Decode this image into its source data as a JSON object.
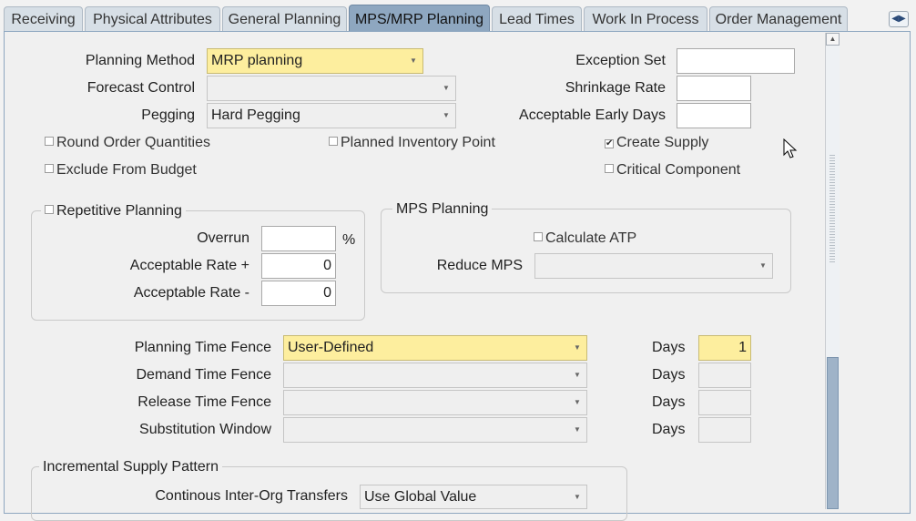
{
  "tabs": [
    {
      "label": "Receiving",
      "active": false
    },
    {
      "label": "Physical Attributes",
      "active": false
    },
    {
      "label": "General Planning",
      "active": false
    },
    {
      "label": "MPS/MRP Planning",
      "active": true
    },
    {
      "label": "Lead Times",
      "active": false
    },
    {
      "label": "Work In Process",
      "active": false
    },
    {
      "label": "Order Management",
      "active": false
    }
  ],
  "tab_nav_icon": "left-right-arrows-icon",
  "main": {
    "planning_method_label": "Planning Method",
    "planning_method_value": "MRP planning",
    "forecast_control_label": "Forecast Control",
    "forecast_control_value": "",
    "pegging_label": "Pegging",
    "pegging_value": "Hard Pegging",
    "exception_set_label": "Exception Set",
    "exception_set_value": "",
    "shrinkage_rate_label": "Shrinkage Rate",
    "shrinkage_rate_value": "",
    "acceptable_early_days_label": "Acceptable Early Days",
    "acceptable_early_days_value": "",
    "checkboxes": {
      "round_order_quantities": {
        "label": "Round Order Quantities",
        "checked": false
      },
      "planned_inventory_point": {
        "label": "Planned Inventory Point",
        "checked": false
      },
      "create_supply": {
        "label": "Create Supply",
        "checked": true
      },
      "exclude_from_budget": {
        "label": "Exclude From Budget",
        "checked": false
      },
      "critical_component": {
        "label": "Critical Component",
        "checked": false
      }
    }
  },
  "repetitive": {
    "title": "Repetitive Planning",
    "checked": false,
    "overrun_label": "Overrun",
    "overrun_value": "",
    "percent_sign": "%",
    "rate_plus_label": "Acceptable Rate +",
    "rate_plus_value": "0",
    "rate_minus_label": "Acceptable Rate -",
    "rate_minus_value": "0"
  },
  "mps": {
    "title": "MPS Planning",
    "calculate_atp_label": "Calculate ATP",
    "calculate_atp_checked": false,
    "reduce_mps_label": "Reduce MPS",
    "reduce_mps_value": ""
  },
  "fences": {
    "days_label": "Days",
    "planning_time_fence_label": "Planning Time Fence",
    "planning_time_fence_value": "User-Defined",
    "planning_time_fence_days": "1",
    "demand_time_fence_label": "Demand Time Fence",
    "demand_time_fence_value": "",
    "demand_time_fence_days": "",
    "release_time_fence_label": "Release Time Fence",
    "release_time_fence_value": "",
    "release_time_fence_days": "",
    "substitution_window_label": "Substitution Window",
    "substitution_window_value": "",
    "substitution_window_days": ""
  },
  "incremental": {
    "title": "Incremental Supply Pattern",
    "inter_org_label": "Continous Inter-Org Transfers",
    "inter_org_value": "Use Global Value"
  },
  "colors": {
    "required_field": "#fdee9e",
    "active_tab": "#8ea7c0",
    "inactive_tab": "#d7dfe6"
  }
}
